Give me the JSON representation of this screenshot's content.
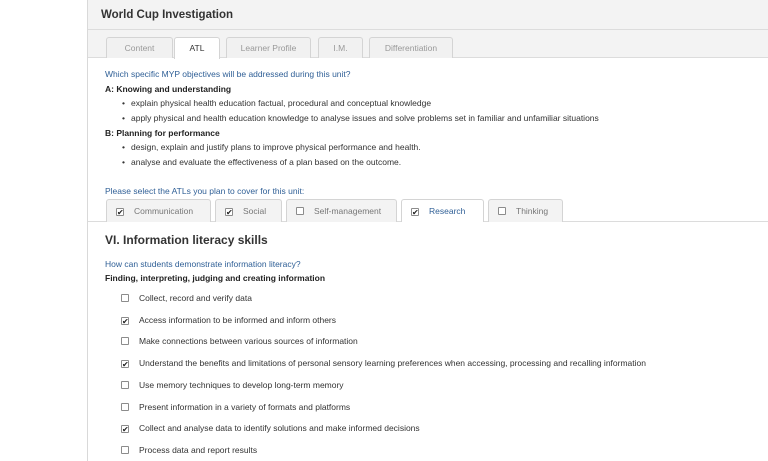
{
  "header": {
    "title": "World Cup Investigation"
  },
  "tabs": [
    {
      "label": "Content",
      "active": false
    },
    {
      "label": "ATL",
      "active": true
    },
    {
      "label": "Learner Profile",
      "active": false
    },
    {
      "label": "I.M.",
      "active": false
    },
    {
      "label": "Differentiation",
      "active": false
    }
  ],
  "objectives": {
    "question": "Which specific MYP objectives will be addressed during this unit?",
    "groups": [
      {
        "heading": "A: Knowing and understanding",
        "items": [
          "explain physical health education factual, procedural and conceptual knowledge",
          "apply physical and health education knowledge to analyse issues and solve problems set in familiar and unfamiliar situations"
        ]
      },
      {
        "heading": "B: Planning for performance",
        "items": [
          "design, explain and justify plans to improve physical performance and health.",
          "analyse and evaluate the effectiveness of a plan based on the outcome."
        ]
      }
    ]
  },
  "atl": {
    "prompt": "Please select the ATLs you plan to cover for this unit:",
    "options": [
      {
        "label": "Communication",
        "checked": true,
        "active": false
      },
      {
        "label": "Social",
        "checked": true,
        "active": false
      },
      {
        "label": "Self-management",
        "checked": false,
        "active": false
      },
      {
        "label": "Research",
        "checked": true,
        "active": true
      },
      {
        "label": "Thinking",
        "checked": false,
        "active": false
      }
    ]
  },
  "section": {
    "title": "VI. Information literacy skills",
    "question": "How can students demonstrate information literacy?",
    "subheading": "Finding, interpreting, judging and creating information",
    "skills": [
      {
        "label": "Collect, record and verify data",
        "checked": false
      },
      {
        "label": "Access information to be informed and inform others",
        "checked": true
      },
      {
        "label": "Make connections between various sources of information",
        "checked": false
      },
      {
        "label": "Understand the benefits and limitations of personal sensory learning preferences when accessing, processing and recalling information",
        "checked": true
      },
      {
        "label": "Use memory techniques to develop long-term memory",
        "checked": false
      },
      {
        "label": "Present information in a variety of formats and platforms",
        "checked": false
      },
      {
        "label": "Collect and analyse data to identify solutions and make informed decisions",
        "checked": true
      },
      {
        "label": "Process data and report results",
        "checked": false
      }
    ]
  },
  "check_glyph": "✔"
}
